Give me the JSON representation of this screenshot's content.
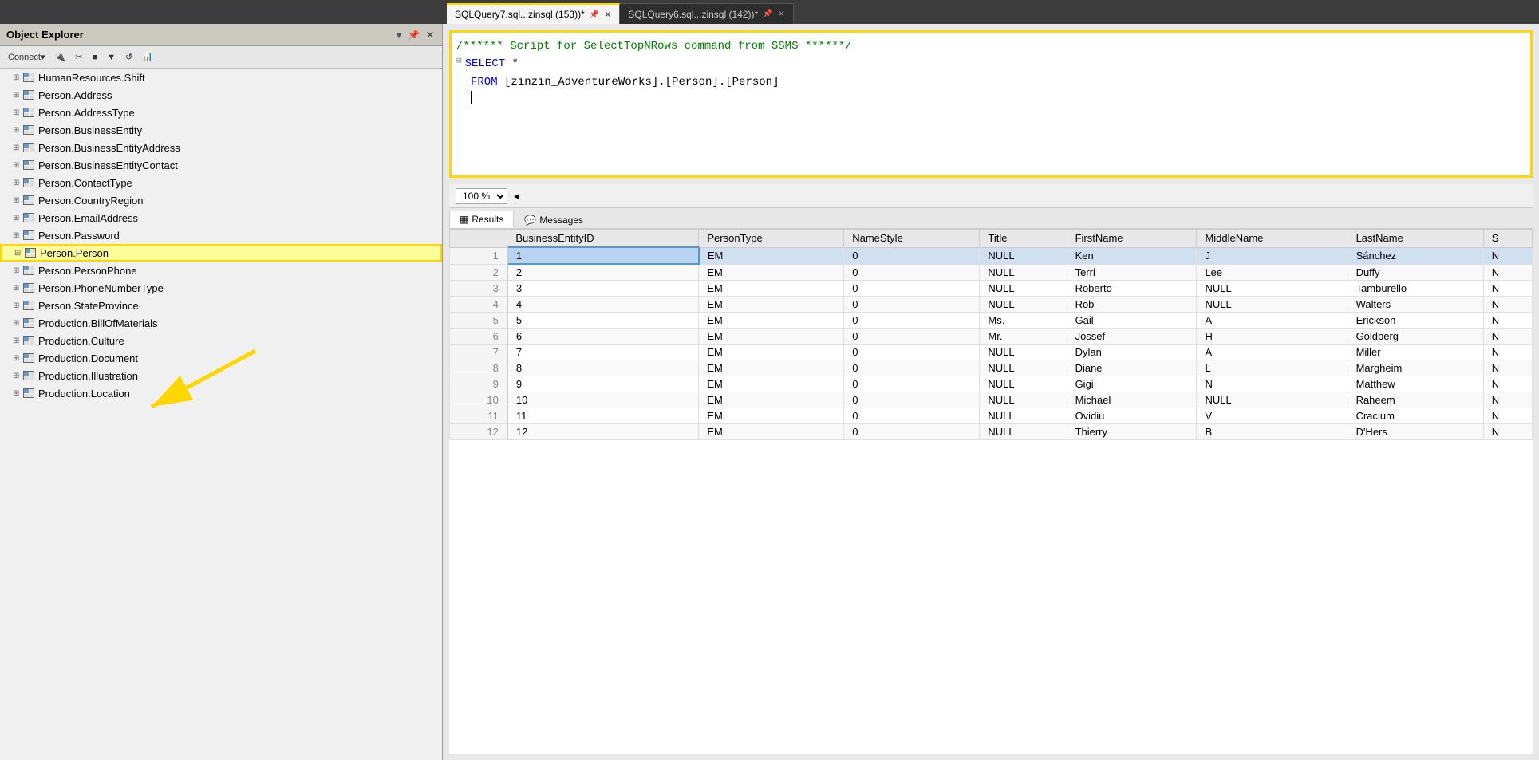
{
  "objectExplorer": {
    "title": "Object Explorer",
    "toolbar": {
      "connect": "Connect▾",
      "buttons": [
        "🔌",
        "🔗",
        "■",
        "▼",
        "↺",
        "📊"
      ]
    },
    "treeItems": [
      {
        "id": "humanresources-shift",
        "label": "HumanResources.Shift",
        "highlighted": false
      },
      {
        "id": "person-address",
        "label": "Person.Address",
        "highlighted": false
      },
      {
        "id": "person-addresstype",
        "label": "Person.AddressType",
        "highlighted": false
      },
      {
        "id": "person-businessentity",
        "label": "Person.BusinessEntity",
        "highlighted": false
      },
      {
        "id": "person-businessentityaddress",
        "label": "Person.BusinessEntityAddress",
        "highlighted": false
      },
      {
        "id": "person-businessentitycontact",
        "label": "Person.BusinessEntityContact",
        "highlighted": false
      },
      {
        "id": "person-contacttype",
        "label": "Person.ContactType",
        "highlighted": false
      },
      {
        "id": "person-countryregion",
        "label": "Person.CountryRegion",
        "highlighted": false
      },
      {
        "id": "person-emailaddress",
        "label": "Person.EmailAddress",
        "highlighted": false
      },
      {
        "id": "person-password",
        "label": "Person.Password",
        "highlighted": false
      },
      {
        "id": "person-person",
        "label": "Person.Person",
        "highlighted": true
      },
      {
        "id": "person-personphone",
        "label": "Person.PersonPhone",
        "highlighted": false
      },
      {
        "id": "person-phonenumbertype",
        "label": "Person.PhoneNumberType",
        "highlighted": false
      },
      {
        "id": "person-stateprovince",
        "label": "Person.StateProvince",
        "highlighted": false
      },
      {
        "id": "production-billofmaterials",
        "label": "Production.BillOfMaterials",
        "highlighted": false
      },
      {
        "id": "production-culture",
        "label": "Production.Culture",
        "highlighted": false
      },
      {
        "id": "production-document",
        "label": "Production.Document",
        "highlighted": false
      },
      {
        "id": "production-illustration",
        "label": "Production.Illustration",
        "highlighted": false
      },
      {
        "id": "production-location",
        "label": "Production.Location",
        "highlighted": false
      }
    ]
  },
  "tabs": [
    {
      "id": "tab1",
      "label": "SQLQuery7.sql...zinsql (153))*",
      "active": true
    },
    {
      "id": "tab2",
      "label": "SQLQuery6.sql...zinsql (142))*",
      "active": false
    }
  ],
  "sqlEditor": {
    "lines": [
      {
        "type": "comment",
        "text": "/****** Script for SelectTopNRows command from SSMS  ******/"
      },
      {
        "type": "keyword+code",
        "keyword": "SELECT",
        "rest": " *"
      },
      {
        "type": "keyword+code",
        "keyword": "FROM",
        "rest": " [zinzin_AdventureWorks].[Person].[Person]"
      },
      {
        "type": "cursor",
        "text": ""
      }
    ]
  },
  "resultsArea": {
    "zoom": "100 %",
    "tabs": [
      "Results",
      "Messages"
    ],
    "activeTab": "Results",
    "columns": [
      "",
      "BusinessEntityID",
      "PersonType",
      "NameStyle",
      "Title",
      "FirstName",
      "MiddleName",
      "LastName",
      "S"
    ],
    "rows": [
      {
        "rowNum": "1",
        "bid": "1",
        "pt": "EM",
        "ns": "0",
        "title": "NULL",
        "fn": "Ken",
        "mn": "J",
        "ln": "Sánchez",
        "s": "N",
        "selected": true
      },
      {
        "rowNum": "2",
        "bid": "2",
        "pt": "EM",
        "ns": "0",
        "title": "NULL",
        "fn": "Terri",
        "mn": "Lee",
        "ln": "Duffy",
        "s": "N",
        "selected": false
      },
      {
        "rowNum": "3",
        "bid": "3",
        "pt": "EM",
        "ns": "0",
        "title": "NULL",
        "fn": "Roberto",
        "mn": "NULL",
        "ln": "Tamburello",
        "s": "N",
        "selected": false
      },
      {
        "rowNum": "4",
        "bid": "4",
        "pt": "EM",
        "ns": "0",
        "title": "NULL",
        "fn": "Rob",
        "mn": "NULL",
        "ln": "Walters",
        "s": "N",
        "selected": false
      },
      {
        "rowNum": "5",
        "bid": "5",
        "pt": "EM",
        "ns": "0",
        "title": "Ms.",
        "fn": "Gail",
        "mn": "A",
        "ln": "Erickson",
        "s": "N",
        "selected": false
      },
      {
        "rowNum": "6",
        "bid": "6",
        "pt": "EM",
        "ns": "0",
        "title": "Mr.",
        "fn": "Jossef",
        "mn": "H",
        "ln": "Goldberg",
        "s": "N",
        "selected": false
      },
      {
        "rowNum": "7",
        "bid": "7",
        "pt": "EM",
        "ns": "0",
        "title": "NULL",
        "fn": "Dylan",
        "mn": "A",
        "ln": "Miller",
        "s": "N",
        "selected": false
      },
      {
        "rowNum": "8",
        "bid": "8",
        "pt": "EM",
        "ns": "0",
        "title": "NULL",
        "fn": "Diane",
        "mn": "L",
        "ln": "Margheim",
        "s": "N",
        "selected": false
      },
      {
        "rowNum": "9",
        "bid": "9",
        "pt": "EM",
        "ns": "0",
        "title": "NULL",
        "fn": "Gigi",
        "mn": "N",
        "ln": "Matthew",
        "s": "N",
        "selected": false
      },
      {
        "rowNum": "10",
        "bid": "10",
        "pt": "EM",
        "ns": "0",
        "title": "NULL",
        "fn": "Michael",
        "mn": "NULL",
        "ln": "Raheem",
        "s": "N",
        "selected": false
      },
      {
        "rowNum": "11",
        "bid": "11",
        "pt": "EM",
        "ns": "0",
        "title": "NULL",
        "fn": "Ovidiu",
        "mn": "V",
        "ln": "Cracium",
        "s": "N",
        "selected": false
      },
      {
        "rowNum": "12",
        "bid": "12",
        "pt": "EM",
        "ns": "0",
        "title": "NULL",
        "fn": "Thierry",
        "mn": "B",
        "ln": "D'Hers",
        "s": "N",
        "selected": false
      }
    ]
  },
  "icons": {
    "expand": "⊞",
    "pin": "📌",
    "close": "✕",
    "results_icon": "▦",
    "messages_icon": "💬"
  }
}
